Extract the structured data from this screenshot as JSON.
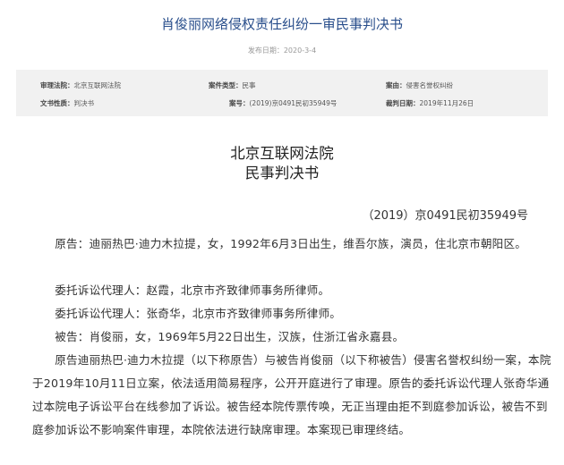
{
  "header": {
    "title": "肖俊丽网络侵权责任纠纷一审民事判决书",
    "pub_date": "发布日期：2020-3-4"
  },
  "info": {
    "court_label": "审理法院：",
    "court_value": "北京互联网法院",
    "case_type_label": "案件类型：",
    "case_type_value": "民事",
    "cause_label": "案由：",
    "cause_value": "侵害名誉权纠纷",
    "doc_type_label": "文书性质：",
    "doc_type_value": "判决书",
    "case_no_label": "案号：",
    "case_no_value": "(2019)京0491民初35949号",
    "judgment_date_label": "裁判日期：",
    "judgment_date_value": "2019年11月26日"
  },
  "document": {
    "court_name": "北京互联网法院",
    "doc_kind": "民事判决书",
    "case_number": "（2019）京0491民初35949号",
    "paragraphs": [
      "原告：迪丽热巴·迪力木拉提，女，1992年6月3日出生，维吾尔族，演员，住北京市朝阳区。",
      "委托诉讼代理人：赵霞，北京市齐致律师事务所律师。",
      "委托诉讼代理人：张奇华，北京市齐致律师事务所律师。",
      "被告：肖俊丽，女，1969年5月22日出生，汉族，住浙江省永嘉县。",
      "原告迪丽热巴·迪力木拉提（以下称原告）与被告肖俊丽（以下称被告）侵害名誉权纠纷一案，本院于2019年10月11日立案，依法适用简易程序，公开开庭进行了审理。原告的委托诉讼代理人张奇华通过本院电子诉讼平台在线参加了诉讼。被告经本院传票传唤，无正当理由拒不到庭参加诉讼，被告不到庭参加诉讼不影响案件审理，本院依法进行缺席审理。本案现已审理终结。"
    ]
  }
}
